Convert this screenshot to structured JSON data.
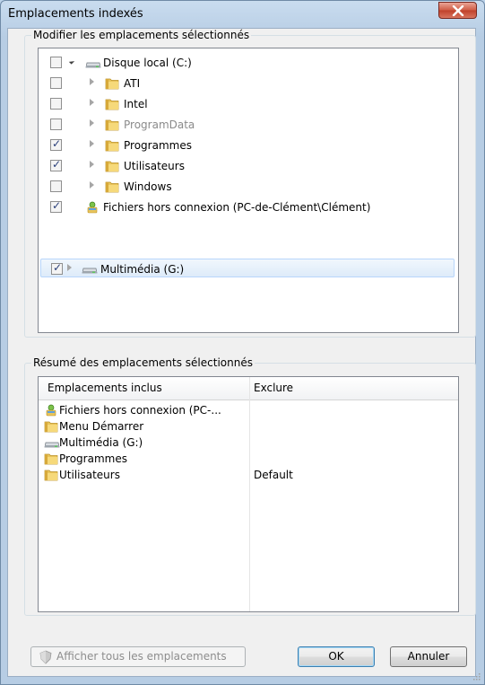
{
  "window": {
    "title": "Emplacements indexés"
  },
  "group_modify": {
    "legend": "Modifier les emplacements sélectionnés",
    "tree": [
      {
        "label": "Disque local (C:)",
        "checked": false,
        "expanded": true,
        "icon": "drive-icon"
      },
      {
        "label": "ATI",
        "checked": false,
        "icon": "folder-icon"
      },
      {
        "label": "Intel",
        "checked": false,
        "icon": "folder-icon"
      },
      {
        "label": "ProgramData",
        "checked": false,
        "icon": "folder-icon",
        "dimmed": true
      },
      {
        "label": "Programmes",
        "checked": true,
        "icon": "folder-icon"
      },
      {
        "label": "Utilisateurs",
        "checked": true,
        "icon": "folder-icon"
      },
      {
        "label": "Windows",
        "checked": false,
        "icon": "folder-icon"
      },
      {
        "label": "Fichiers hors connexion (PC-de-Clément\\Clément)",
        "checked": true,
        "icon": "offline-files-icon"
      },
      {
        "label": "Multimédia (G:)",
        "checked": true,
        "icon": "drive-icon",
        "selected": true
      }
    ]
  },
  "group_summary": {
    "legend": "Résumé des emplacements sélectionnés",
    "columns": {
      "included": "Emplacements inclus",
      "exclude": "Exclure"
    },
    "rows": [
      {
        "included": "Fichiers hors connexion (PC-...",
        "exclude": "",
        "icon": "offline-files-icon"
      },
      {
        "included": "Menu Démarrer",
        "exclude": "",
        "icon": "folder-icon"
      },
      {
        "included": "Multimédia (G:)",
        "exclude": "",
        "icon": "drive-icon"
      },
      {
        "included": "Programmes",
        "exclude": "",
        "icon": "folder-icon"
      },
      {
        "included": "Utilisateurs",
        "exclude": "Default",
        "icon": "folder-icon"
      }
    ]
  },
  "buttons": {
    "show_all": "Afficher tous les emplacements",
    "ok": "OK",
    "cancel": "Annuler"
  },
  "colors": {
    "accent": "#3c7fb1",
    "folder": "#e9c45a",
    "selection": "#deebf9"
  }
}
